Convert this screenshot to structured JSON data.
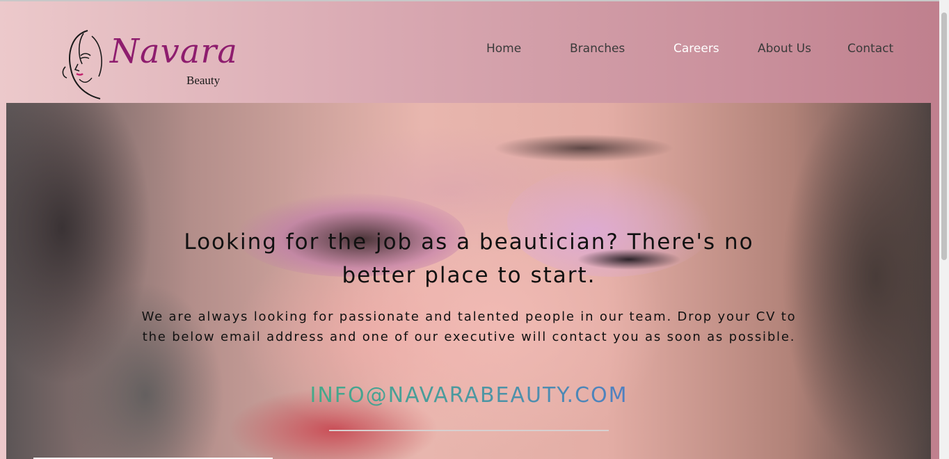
{
  "brand": {
    "name": "Navara",
    "sub": "Beauty"
  },
  "nav": {
    "items": [
      "Home",
      "Branches",
      "Careers",
      "About Us",
      "Contact"
    ],
    "active": "Careers"
  },
  "hero": {
    "title": "Looking for the job as a beautician? There's no better place to start.",
    "description": "We are always looking for passionate and talented people in our team. Drop your CV to the below email address and one of our executive will contact you as soon as possible.",
    "email": "INFO@NAVARABEAUTY.COM"
  },
  "colors": {
    "brand": "#8e1d6e",
    "email_gradient_start": "#3fb57a",
    "email_gradient_end": "#4f6fd8",
    "header_gradient_start": "#ecc9cb",
    "header_gradient_end": "#bf7f8d"
  },
  "icons": {
    "logo": "woman-face-line-art-icon"
  }
}
